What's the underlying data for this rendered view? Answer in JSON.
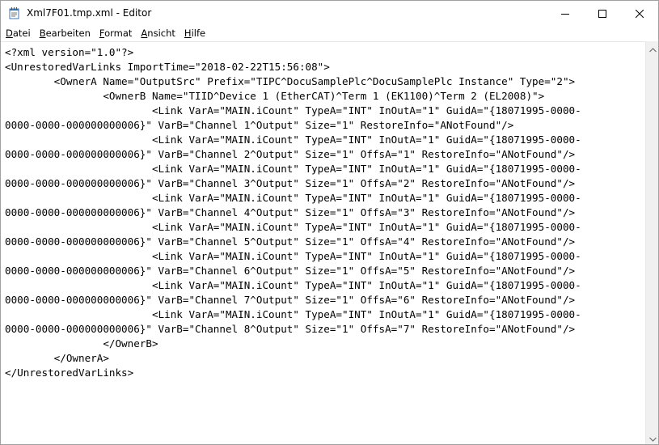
{
  "window": {
    "title": "Xml7F01.tmp.xml - Editor"
  },
  "menu": {
    "items": [
      {
        "accel": "D",
        "rest": "atei"
      },
      {
        "accel": "B",
        "rest": "earbeiten"
      },
      {
        "accel": "F",
        "rest": "ormat"
      },
      {
        "accel": "A",
        "rest": "nsicht"
      },
      {
        "accel": "H",
        "rest": "ilfe"
      }
    ]
  },
  "document": {
    "lines": [
      "<?xml version=\"1.0\"?>",
      "<UnrestoredVarLinks ImportTime=\"2018-02-22T15:56:08\">",
      "        <OwnerA Name=\"OutputSrc\" Prefix=\"TIPC^DocuSamplePlc^DocuSamplePlc Instance\" Type=\"2\">",
      "                <OwnerB Name=\"TIID^Device 1 (EtherCAT)^Term 1 (EK1100)^Term 2 (EL2008)\">",
      "                        <Link VarA=\"MAIN.iCount\" TypeA=\"INT\" InOutA=\"1\" GuidA=\"{18071995-0000-",
      "0000-0000-000000000006}\" VarB=\"Channel 1^Output\" Size=\"1\" RestoreInfo=\"ANotFound\"/>",
      "                        <Link VarA=\"MAIN.iCount\" TypeA=\"INT\" InOutA=\"1\" GuidA=\"{18071995-0000-",
      "0000-0000-000000000006}\" VarB=\"Channel 2^Output\" Size=\"1\" OffsA=\"1\" RestoreInfo=\"ANotFound\"/>",
      "                        <Link VarA=\"MAIN.iCount\" TypeA=\"INT\" InOutA=\"1\" GuidA=\"{18071995-0000-",
      "0000-0000-000000000006}\" VarB=\"Channel 3^Output\" Size=\"1\" OffsA=\"2\" RestoreInfo=\"ANotFound\"/>",
      "                        <Link VarA=\"MAIN.iCount\" TypeA=\"INT\" InOutA=\"1\" GuidA=\"{18071995-0000-",
      "0000-0000-000000000006}\" VarB=\"Channel 4^Output\" Size=\"1\" OffsA=\"3\" RestoreInfo=\"ANotFound\"/>",
      "                        <Link VarA=\"MAIN.iCount\" TypeA=\"INT\" InOutA=\"1\" GuidA=\"{18071995-0000-",
      "0000-0000-000000000006}\" VarB=\"Channel 5^Output\" Size=\"1\" OffsA=\"4\" RestoreInfo=\"ANotFound\"/>",
      "                        <Link VarA=\"MAIN.iCount\" TypeA=\"INT\" InOutA=\"1\" GuidA=\"{18071995-0000-",
      "0000-0000-000000000006}\" VarB=\"Channel 6^Output\" Size=\"1\" OffsA=\"5\" RestoreInfo=\"ANotFound\"/>",
      "                        <Link VarA=\"MAIN.iCount\" TypeA=\"INT\" InOutA=\"1\" GuidA=\"{18071995-0000-",
      "0000-0000-000000000006}\" VarB=\"Channel 7^Output\" Size=\"1\" OffsA=\"6\" RestoreInfo=\"ANotFound\"/>",
      "                        <Link VarA=\"MAIN.iCount\" TypeA=\"INT\" InOutA=\"1\" GuidA=\"{18071995-0000-",
      "0000-0000-000000000006}\" VarB=\"Channel 8^Output\" Size=\"1\" OffsA=\"7\" RestoreInfo=\"ANotFound\"/>",
      "                </OwnerB>",
      "        </OwnerA>",
      "</UnrestoredVarLinks>"
    ]
  },
  "icons": {
    "app": "notepad-icon",
    "minimize": "minimize-icon",
    "maximize": "maximize-icon",
    "close": "close-icon",
    "scroll_up": "scroll-up-arrow-icon",
    "scroll_down": "scroll-down-arrow-icon"
  }
}
